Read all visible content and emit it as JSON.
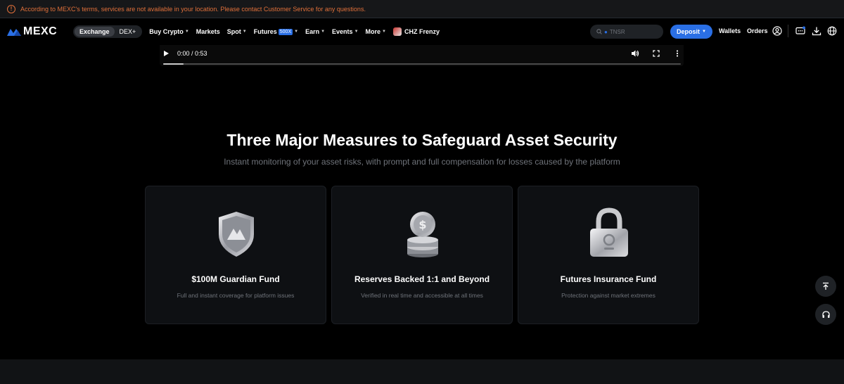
{
  "notice": {
    "text": "According to MEXC's terms, services are not available in your location. Please contact Customer Service for any questions."
  },
  "header": {
    "brand": "MEXC",
    "segment": [
      "Exchange",
      "DEX+"
    ],
    "nav": {
      "buy_crypto": "Buy Crypto",
      "markets": "Markets",
      "spot": "Spot",
      "futures": "Futures",
      "futures_badge": "500X",
      "earn": "Earn",
      "events": "Events",
      "more": "More",
      "promo": "CHZ Frenzy"
    },
    "search": {
      "placeholder": "TNSR"
    },
    "deposit_label": "Deposit",
    "wallets_label": "Wallets",
    "orders_label": "Orders",
    "icons": [
      "user-icon",
      "chat-icon",
      "download-icon",
      "globe-icon"
    ],
    "accent": "#2a6fe5"
  },
  "video": {
    "time": "0:00 / 0:53",
    "progress": 0.04
  },
  "section": {
    "title": "Three Major Measures to Safeguard Asset Security",
    "subtitle": "Instant monitoring of your asset risks, with prompt and full compensation for losses caused by the platform",
    "cards": [
      {
        "title": "$100M Guardian Fund",
        "desc": "Full and instant coverage for platform issues",
        "icon": "shield-icon"
      },
      {
        "title": "Reserves Backed 1:1 and Beyond",
        "desc": "Verified in real time and accessible at all times",
        "icon": "coins-icon"
      },
      {
        "title": "Futures Insurance Fund",
        "desc": "Protection against market extremes",
        "icon": "padlock-icon"
      }
    ]
  },
  "notice_color": "#e0703a"
}
